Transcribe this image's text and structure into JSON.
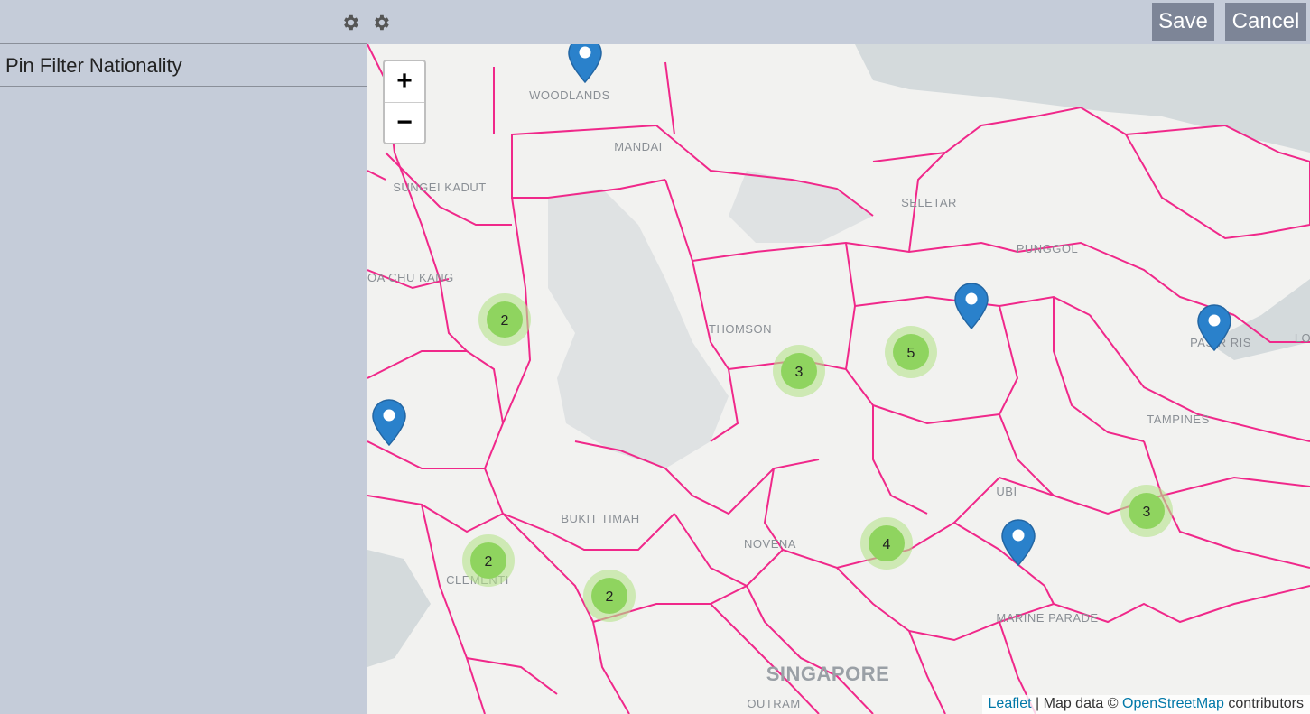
{
  "sidebar": {
    "item_label": "Pin Filter Nationality"
  },
  "toolbar": {
    "save_label": "Save",
    "cancel_label": "Cancel"
  },
  "map": {
    "zoom_in": "+",
    "zoom_out": "−",
    "labels": {
      "woodlands": "WOODLANDS",
      "mandai": "MANDAI",
      "sungei_kadut": "SUNGEI KADUT",
      "seletar": "SELETAR",
      "punggol": "PUNGGOL",
      "choa_chu_kang": "CHOA CHU KANG",
      "thomson": "THOMSON",
      "pasir_ris": "PASIR RIS",
      "tampines": "TAMPINES",
      "bukit_timah": "BUKIT TIMAH",
      "novena": "NOVENA",
      "ubi": "UBI",
      "clementi": "CLEMENTI",
      "marine_parade": "MARINE PARADE",
      "singapore": "SINGAPORE",
      "outram": "OUTRAM",
      "lo": "LO"
    },
    "clusters": [
      "2",
      "3",
      "5",
      "2",
      "2",
      "4",
      "3"
    ],
    "attribution": {
      "leaflet": "Leaflet",
      "sep": " | Map data © ",
      "osm": "OpenStreetMap",
      "suffix": " contributors"
    },
    "colors": {
      "boundary": "#f0288a",
      "cluster_inner": "#8fd45f",
      "cluster_outer": "#b5e28c",
      "marker": "#2a81cb",
      "water": "#d4dadc"
    }
  }
}
